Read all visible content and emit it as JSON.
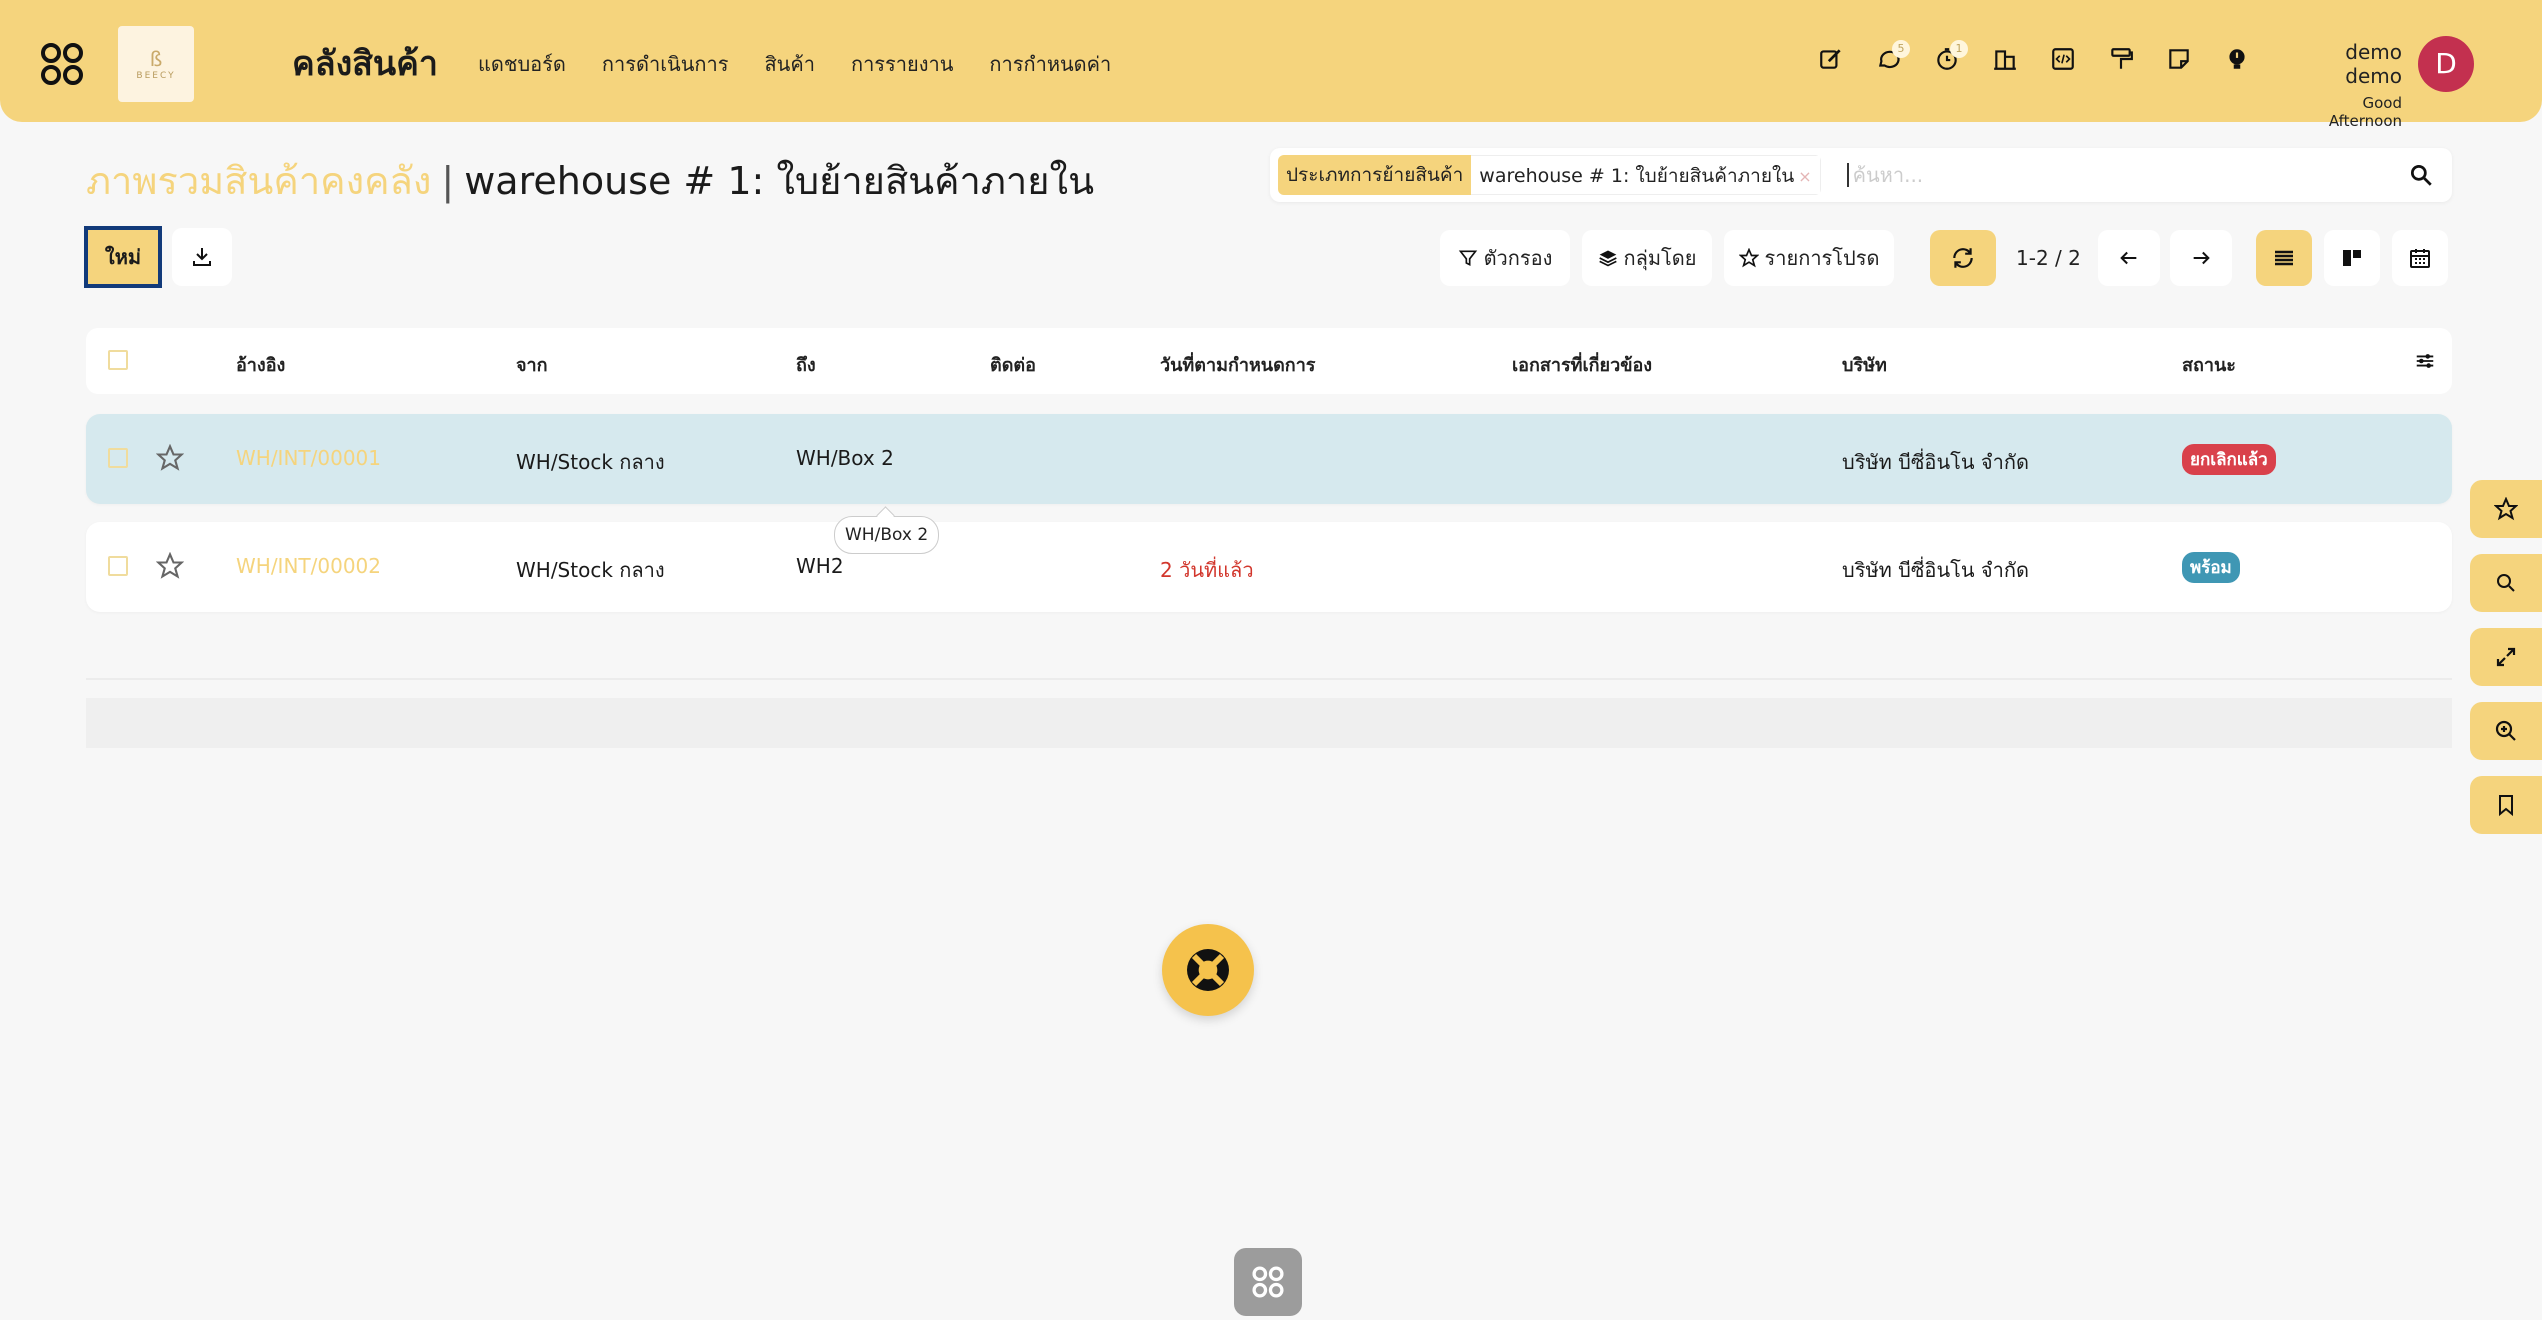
{
  "header": {
    "logo_text": "BEECY",
    "app_title": "คลังสินค้า",
    "menu": [
      "แดชบอร์ด",
      "การดำเนินการ",
      "สินค้า",
      "การรายงาน",
      "การกำหนดค่า"
    ],
    "messages_count": "5",
    "activity_count": "1",
    "user_name": "demo demo",
    "greeting": "Good Afternoon",
    "avatar_letter": "D"
  },
  "breadcrumb": {
    "parent": "ภาพรวมสินค้าคงคลัง",
    "separator": "|",
    "current": "warehouse # 1: ใบย้ายสินค้าภายใน"
  },
  "search": {
    "facet_label": "ประเภทการย้ายสินค้า",
    "facet_value": "warehouse # 1: ใบย้ายสินค้าภายใน",
    "placeholder": "ค้นหา..."
  },
  "toolbar": {
    "new_label": "ใหม่",
    "filters_label": "ตัวกรอง",
    "group_by_label": "กลุ่มโดย",
    "favorites_label": "รายการโปรด",
    "pager": "1-2 / 2"
  },
  "table": {
    "columns": [
      "อ้างอิง",
      "จาก",
      "ถึง",
      "ติดต่อ",
      "วันที่ตามกำหนดการ",
      "เอกสารที่เกี่ยวข้อง",
      "บริษัท",
      "สถานะ"
    ],
    "rows": [
      {
        "reference": "WH/INT/00001",
        "from": "WH/Stock กลาง",
        "to": "WH/Box 2",
        "contact": "",
        "scheduled": "",
        "source": "",
        "company": "บริษัท บีซี่อินโน จำกัด",
        "status": "ยกเลิกแล้ว",
        "status_color": "#d9414b"
      },
      {
        "reference": "WH/INT/00002",
        "from": "WH/Stock กลาง",
        "to": "WH2",
        "contact": "",
        "scheduled": "2 วันที่แล้ว",
        "source": "",
        "company": "บริษัท บีซี่อินโน จำกัด",
        "status": "พร้อม",
        "status_color": "#3f97b4"
      }
    ]
  },
  "tooltip": "WH/Box 2",
  "colors": {
    "accent": "#f5d47d",
    "selected_row": "#d6e9ee",
    "due_text": "#d2362c"
  }
}
